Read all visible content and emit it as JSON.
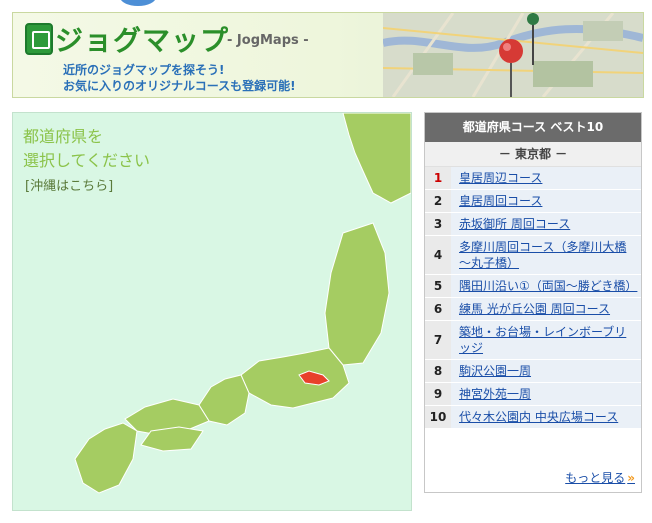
{
  "banner": {
    "title": "ジョグマップ",
    "subtitle": "- JogMaps -",
    "line1": "近所のジョグマップを探そう!",
    "line2": "お気に入りのオリジナルコースも登録可能!"
  },
  "map": {
    "title_line1": "都道府県を",
    "title_line2": "選択してください",
    "okinawa_link": "[沖縄はこちら]",
    "highlight_color": "#e8412b",
    "land_color": "#a5cc62"
  },
  "ranking": {
    "header": "都道府県コース ベスト10",
    "prefecture": "－ 東京都 －",
    "items": [
      {
        "rank": "1",
        "name": "皇居周辺コース"
      },
      {
        "rank": "2",
        "name": "皇居周回コース"
      },
      {
        "rank": "3",
        "name": "赤坂御所 周回コース"
      },
      {
        "rank": "4",
        "name": "多摩川周回コース（多摩川大橋～丸子橋）"
      },
      {
        "rank": "5",
        "name": "隅田川沿い①（両国～勝どき橋）"
      },
      {
        "rank": "6",
        "name": "練馬 光が丘公園 周回コース"
      },
      {
        "rank": "7",
        "name": "築地・お台場・レインボーブリッジ"
      },
      {
        "rank": "8",
        "name": "駒沢公園一周"
      },
      {
        "rank": "9",
        "name": "神宮外苑一周"
      },
      {
        "rank": "10",
        "name": "代々木公園内 中央広場コース"
      }
    ],
    "more": "もっと見る",
    "more_arrow": "»"
  }
}
